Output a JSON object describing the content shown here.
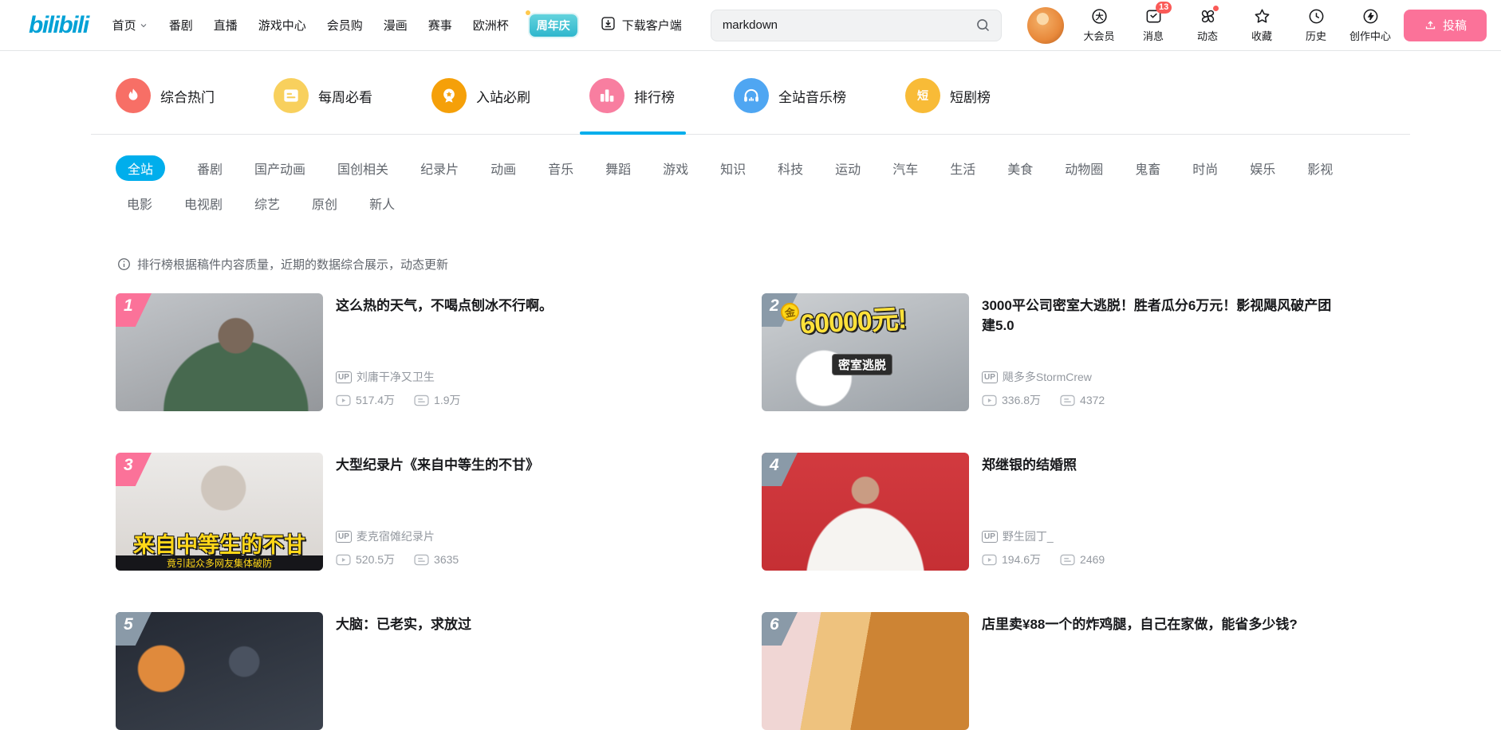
{
  "accent": {
    "brand_blue": "#00aeec",
    "upload_pink": "#fb7299",
    "badge_red": "#fa5a57",
    "rank_top_color": "#fb7299",
    "rank_normal_color": "#8a9aa8"
  },
  "header": {
    "logo_text": "bilibili",
    "nav_items": [
      {
        "label": "首页",
        "name": "nav-item-home",
        "caret": true
      },
      {
        "label": "番剧",
        "name": "nav-item-bangumi"
      },
      {
        "label": "直播",
        "name": "nav-item-live"
      },
      {
        "label": "游戏中心",
        "name": "nav-item-game-center"
      },
      {
        "label": "会员购",
        "name": "nav-item-vip-shop"
      },
      {
        "label": "漫画",
        "name": "nav-item-manga"
      },
      {
        "label": "赛事",
        "name": "nav-item-esports"
      },
      {
        "label": "欧洲杯",
        "name": "nav-item-euro-cup"
      }
    ],
    "promo_label": "周年庆",
    "download_label": "下载客户端",
    "search_value": "markdown",
    "user_menu": [
      {
        "label": "大会员",
        "icon": "vip-icon",
        "name": "entry-vip"
      },
      {
        "label": "消息",
        "icon": "message-icon",
        "name": "entry-messages",
        "badge": "13"
      },
      {
        "label": "动态",
        "icon": "dynamics-icon",
        "name": "entry-dynamics",
        "dot": true
      },
      {
        "label": "收藏",
        "icon": "favorites-icon",
        "name": "entry-favorites"
      },
      {
        "label": "历史",
        "icon": "history-icon",
        "name": "entry-history"
      },
      {
        "label": "创作中心",
        "icon": "creator-icon",
        "name": "entry-creator-center"
      }
    ],
    "upload_label": "投稿"
  },
  "rank_tabs": [
    {
      "label": "综合热门",
      "icon": "flame-icon",
      "color": "#f76f66",
      "active": false
    },
    {
      "label": "每周必看",
      "icon": "calendar-icon",
      "color": "#f8d05d",
      "active": false
    },
    {
      "label": "入站必刷",
      "icon": "medal-icon",
      "color": "#f5a009",
      "active": false
    },
    {
      "label": "排行榜",
      "icon": "chart-icon",
      "color": "#f87ea0",
      "active": true
    },
    {
      "label": "全站音乐榜",
      "icon": "music-icon",
      "color": "#4fa6f2",
      "active": false
    },
    {
      "label": "短剧榜",
      "icon": "short-drama-icon",
      "color": "#f8bb37",
      "active": false
    }
  ],
  "categories_row1": [
    {
      "label": "全站",
      "active": true
    },
    {
      "label": "番剧"
    },
    {
      "label": "国产动画"
    },
    {
      "label": "国创相关"
    },
    {
      "label": "纪录片"
    },
    {
      "label": "动画"
    },
    {
      "label": "音乐"
    },
    {
      "label": "舞蹈"
    },
    {
      "label": "游戏"
    },
    {
      "label": "知识"
    },
    {
      "label": "科技"
    },
    {
      "label": "运动"
    },
    {
      "label": "汽车"
    },
    {
      "label": "生活"
    },
    {
      "label": "美食"
    },
    {
      "label": "动物圈"
    },
    {
      "label": "鬼畜"
    },
    {
      "label": "时尚"
    },
    {
      "label": "娱乐"
    },
    {
      "label": "影视"
    }
  ],
  "categories_row2": [
    {
      "label": "电影"
    },
    {
      "label": "电视剧"
    },
    {
      "label": "综艺"
    },
    {
      "label": "原创"
    },
    {
      "label": "新人"
    }
  ],
  "notice": "排行榜根据稿件内容质量，近期的数据综合展示，动态更新",
  "videos": [
    {
      "rank": "1",
      "rank_color": "#fb7299",
      "title": "这么热的天气，不喝点刨冰不行啊。",
      "uploader": "刘庸干净又卫生",
      "plays": "517.4万",
      "danmaku": "1.9万",
      "thumb_bg": "radial-gradient(circle at 58% 36%, #7a685a 0 12%, rgba(0,0,0,0) 13%), radial-gradient(ellipse at 58% 100%, #47694f 0 42%, rgba(0,0,0,0) 43%), linear-gradient(160deg,#c2c5c9,#94979b)",
      "overlays": []
    },
    {
      "rank": "2",
      "rank_color": "#8a9aa8",
      "title": "3000平公司密室大逃脱！胜者瓜分6万元！影视飓风破产团建5.0",
      "uploader": "飓多多StormCrew",
      "plays": "336.8万",
      "danmaku": "4372",
      "thumb_bg": "radial-gradient(circle at 30% 72%, #ffffff 0 16%, rgba(0,0,0,0) 17%), linear-gradient(160deg,#cdd0d3,#9aa0a6)",
      "overlays": [
        {
          "text": "金",
          "class": "ov-coin"
        },
        {
          "text": "60000元!",
          "class": "ov-big-yellow"
        },
        {
          "text": "密室逃脱",
          "class": "ov-badge-dark"
        }
      ]
    },
    {
      "rank": "3",
      "rank_color": "#fb7299",
      "title": "大型纪录片《来自中等生的不甘》",
      "uploader": "麦克宿傩纪录片",
      "plays": "520.5万",
      "danmaku": "3635",
      "thumb_bg": "radial-gradient(circle at 52% 30%, #cfc6bd 0 16%, rgba(0,0,0,0) 17%), linear-gradient(180deg,#eceae8,#d8d4d0)",
      "overlays": [
        {
          "text": "来自中等生的不甘",
          "class": "ov-caption-lg"
        },
        {
          "text": "竟引起众多网友集体破防",
          "class": "ov-caption-sm"
        }
      ]
    },
    {
      "rank": "4",
      "rank_color": "#8a9aa8",
      "title": "郑继银的结婚照",
      "uploader": "野生园丁_",
      "plays": "194.6万",
      "danmaku": "2469",
      "thumb_bg": "radial-gradient(circle at 50% 32%, #c99c83 0 10%, rgba(0,0,0,0) 11%), radial-gradient(ellipse at 50% 110%, #f6f4f1 0 40%, rgba(0,0,0,0) 41%), linear-gradient(#d23a3f,#c52f34)",
      "overlays": []
    },
    {
      "rank": "5",
      "rank_color": "#8a9aa8",
      "title": "大脑：已老实，求放过",
      "thumb_bg": "radial-gradient(circle at 22% 48%, #e08a3c 0 13%, rgba(0,0,0,0) 14%), radial-gradient(circle at 62% 42%, #4a5260 0 10%, rgba(0,0,0,0) 11%), linear-gradient(160deg,#242933,#3c434e)",
      "overlays": []
    },
    {
      "rank": "6",
      "rank_color": "#8a9aa8",
      "title": "店里卖¥88一个的炸鸡腿，自己在家做，能省多少钱?",
      "thumb_bg": "linear-gradient(100deg,#f0d6d4 0 26%,#eec27e 26% 48%,#cd8434 48% 100%)",
      "overlays": []
    }
  ]
}
